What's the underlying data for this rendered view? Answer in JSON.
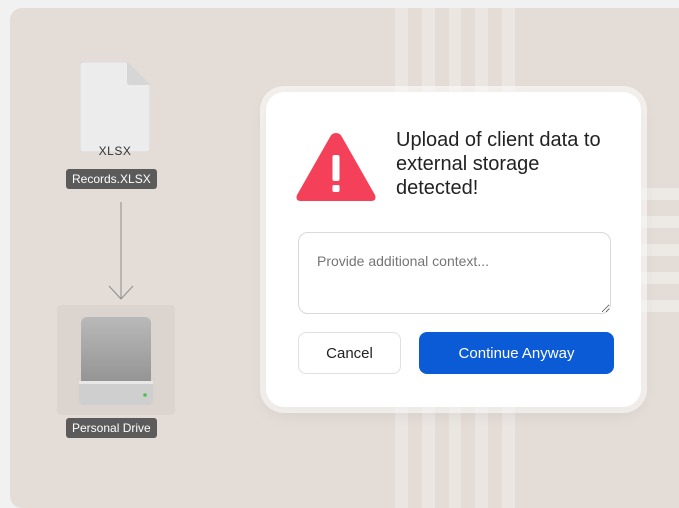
{
  "file": {
    "extension": "XLSX",
    "name": "Records.XLSX",
    "icon": "spreadsheet-file-icon"
  },
  "drive": {
    "name": "Personal Drive",
    "icon": "hard-drive-icon"
  },
  "dialog": {
    "icon": "warning-triangle-icon",
    "title": "Upload of client data to external storage detected!",
    "context_placeholder": "Provide additional context...",
    "cancel_label": "Cancel",
    "continue_label": "Continue Anyway"
  },
  "colors": {
    "warning_red": "#f5405a",
    "primary_blue": "#0b5bd7",
    "background": "#e4ddd7"
  }
}
